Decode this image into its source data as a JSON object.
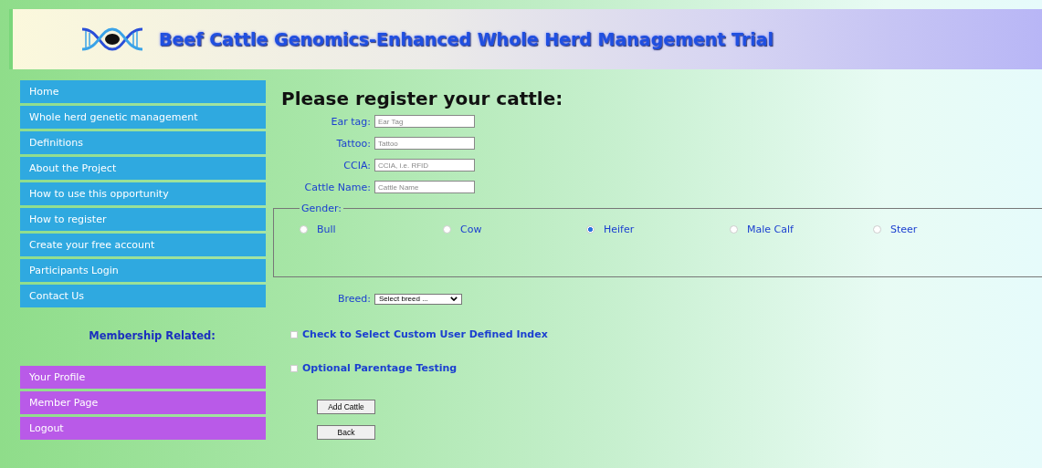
{
  "header": {
    "title": "Beef Cattle Genomics-Enhanced Whole Herd Management Trial"
  },
  "nav": {
    "items": [
      {
        "label": "Home"
      },
      {
        "label": "Whole herd genetic management"
      },
      {
        "label": "Definitions"
      },
      {
        "label": "About the Project"
      },
      {
        "label": "How to use this opportunity"
      },
      {
        "label": "How to register"
      },
      {
        "label": "Create your free account"
      },
      {
        "label": "Participants Login"
      },
      {
        "label": "Contact Us"
      }
    ]
  },
  "membership": {
    "heading": "Membership Related:",
    "items": [
      {
        "label": "Your Profile"
      },
      {
        "label": "Member Page"
      },
      {
        "label": "Logout"
      }
    ]
  },
  "form": {
    "title": "Please register your cattle:",
    "fields": [
      {
        "label": "Ear tag:",
        "placeholder": "Ear Tag"
      },
      {
        "label": "Tattoo:",
        "placeholder": "Tattoo"
      },
      {
        "label": "CCIA:",
        "placeholder": "CCIA, i.e. RFID"
      },
      {
        "label": "Cattle Name:",
        "placeholder": "Cattle Name"
      }
    ],
    "gender": {
      "legend": "Gender:",
      "options": [
        {
          "label": "Bull",
          "selected": false
        },
        {
          "label": "Cow",
          "selected": false
        },
        {
          "label": "Heifer",
          "selected": true
        },
        {
          "label": "Male Calf",
          "selected": false
        },
        {
          "label": "Steer",
          "selected": false
        }
      ]
    },
    "breed": {
      "label": "Breed:",
      "value": "Select breed ..."
    },
    "checkboxes": [
      {
        "label": "Check to Select Custom User Defined Index",
        "checked": false
      },
      {
        "label": "Optional Parentage Testing",
        "checked": false
      }
    ],
    "buttons": [
      "Add Cattle",
      "Back"
    ]
  }
}
